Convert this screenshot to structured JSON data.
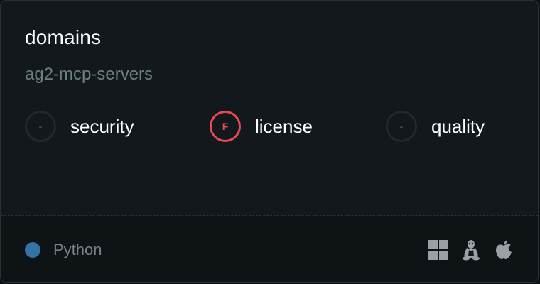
{
  "card": {
    "title": "domains",
    "subtitle": "ag2-mcp-servers"
  },
  "metrics": [
    {
      "label": "security",
      "grade": "-",
      "status": "none"
    },
    {
      "label": "license",
      "grade": "F",
      "status": "fail"
    },
    {
      "label": "quality",
      "grade": "-",
      "status": "none"
    }
  ],
  "footer": {
    "language": "Python",
    "language_color": "#3572A5",
    "platforms": [
      "windows-icon",
      "linux-icon",
      "apple-icon"
    ]
  },
  "colors": {
    "fail": "#e84a4f",
    "muted": "#6b807f"
  }
}
